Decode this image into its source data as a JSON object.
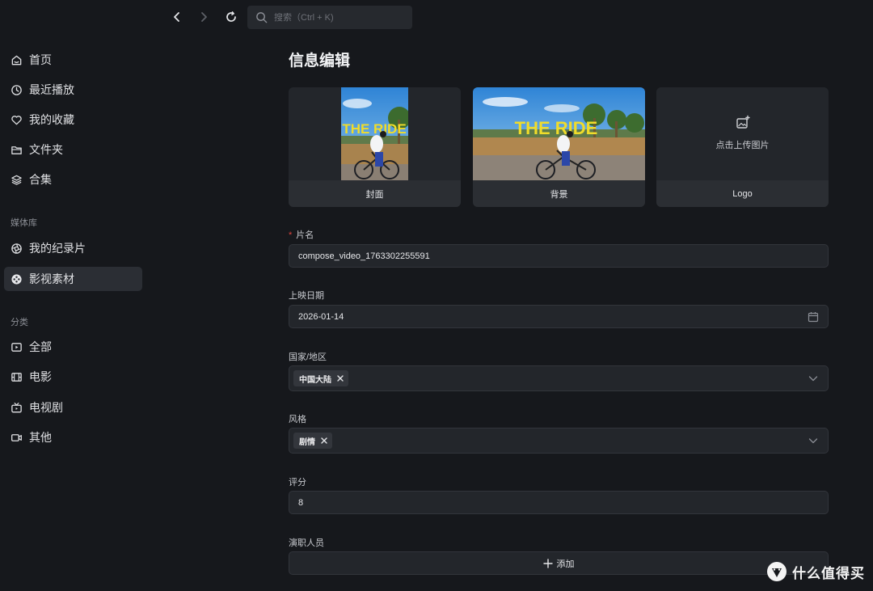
{
  "search": {
    "placeholder": "搜索（Ctrl + K)"
  },
  "sidebar": {
    "items": [
      {
        "label": "首页",
        "icon": "home-icon"
      },
      {
        "label": "最近播放",
        "icon": "clock-icon"
      },
      {
        "label": "我的收藏",
        "icon": "heart-icon"
      },
      {
        "label": "文件夹",
        "icon": "folder-icon"
      },
      {
        "label": "合集",
        "icon": "layers-icon"
      }
    ],
    "library_title": "媒体库",
    "library": [
      {
        "label": "我的纪录片",
        "icon": "aperture-icon"
      },
      {
        "label": "影视素材",
        "icon": "film-reel-icon",
        "active": true
      }
    ],
    "category_title": "分类",
    "categories": [
      {
        "label": "全部",
        "icon": "play-square-icon"
      },
      {
        "label": "电影",
        "icon": "film-strip-icon"
      },
      {
        "label": "电视剧",
        "icon": "tv-icon"
      },
      {
        "label": "其他",
        "icon": "video-camera-icon"
      }
    ]
  },
  "main": {
    "title": "信息编辑",
    "images": {
      "cover_label": "封面",
      "background_label": "背景",
      "logo_label": "Logo",
      "upload_hint": "点击上传图片",
      "photo_text": "THE RIDE"
    },
    "fields": {
      "name_label": "片名",
      "name_value": "compose_video_1763302255591",
      "date_label": "上映日期",
      "date_value": "2026-01-14",
      "region_label": "国家/地区",
      "region_tag": "中国大陆",
      "genre_label": "风格",
      "genre_tag": "剧情",
      "rating_label": "评分",
      "rating_value": "8",
      "cast_label": "演职人员",
      "add_label": "添加"
    }
  },
  "watermark": {
    "text": "什么值得买"
  },
  "colors": {
    "background": "#16181c",
    "panel": "#23262b",
    "required": "#e0443e"
  }
}
